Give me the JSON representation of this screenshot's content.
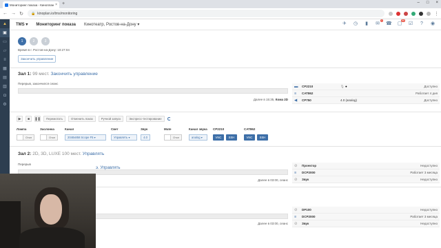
{
  "browser": {
    "tab_title": "Мониторинг показа - Кинопланета",
    "url": "kinoplan.io/tms/monitoring"
  },
  "app": {
    "brand": "TMS",
    "section": "Мониторинг показа",
    "cinema": "Кинотеатр, Ростов-на-Дону",
    "badges": {
      "notifications": "1",
      "messages": "50"
    }
  },
  "steps": [
    "1",
    "2",
    "3"
  ],
  "time_text": "Время в г. Ростов-на-Дону: 10:27:04",
  "end_control_label": "Закончить управление",
  "halls": [
    {
      "title": "Зал 1:",
      "subtitle": "99 мест.",
      "link": "Закончить управление",
      "status": "Перерыв, закончился сеанс",
      "next": "Далее в 15:35,",
      "next_hall": "Кома 2D",
      "devices": [
        {
          "name": "CP2210",
          "mid": "",
          "state": "Доступно",
          "icon": "projector-icon"
        },
        {
          "name": "CAT862",
          "mid": "",
          "state": "Работает 4 дня",
          "icon": "server-icon"
        },
        {
          "name": "CP750",
          "mid": "4.0 (analog)",
          "state": "Доступно",
          "icon": "audio-icon"
        }
      ]
    },
    {
      "title": "Зал 2:",
      "subtitle": "2D, 3D, LUXE 100 мест.",
      "link": "Управлять",
      "status": "Перерыв",
      "next": "Далее в 03:00, сеанс",
      "devices": [
        {
          "name": "Проектор",
          "mid": "",
          "state": "Недоступно",
          "icon": "blocked-icon"
        },
        {
          "name": "DCP2000",
          "mid": "",
          "state": "Работает 3 месяца",
          "icon": "server-icon"
        },
        {
          "name": "Звук",
          "mid": "",
          "state": "Недоступно",
          "icon": "blocked-icon"
        }
      ]
    },
    {
      "title_fragment": "э. Управлять",
      "next": "Далее в 03:00, сеанс",
      "devices": [
        {
          "name": "DP100",
          "mid": "",
          "state": "Недоступно",
          "icon": "blocked-icon"
        },
        {
          "name": "DCP2000",
          "mid": "",
          "state": "Работает 3 месяца",
          "icon": "server-icon"
        },
        {
          "name": "Звук",
          "mid": "",
          "state": "Недоступно",
          "icon": "blocked-icon"
        }
      ]
    }
  ],
  "controls": {
    "buttons": [
      "Перемотать",
      "Отменить показ",
      "Ручной запуск",
      "Экспресс-тестирование"
    ],
    "headers": [
      "Лампа",
      "Заслонка",
      "Канал",
      "Свет",
      "Звук",
      "Mute",
      "Канал звука",
      "CP2210",
      "CAT862"
    ],
    "lamp": "Откл",
    "shutter": "Откл",
    "channel": "2048x858 Scope F5",
    "light": "Управлять",
    "volume": "4.0",
    "mute": "Откл",
    "sound_channel": "analog",
    "vnc": "VNC",
    "ssh": "SSH"
  }
}
